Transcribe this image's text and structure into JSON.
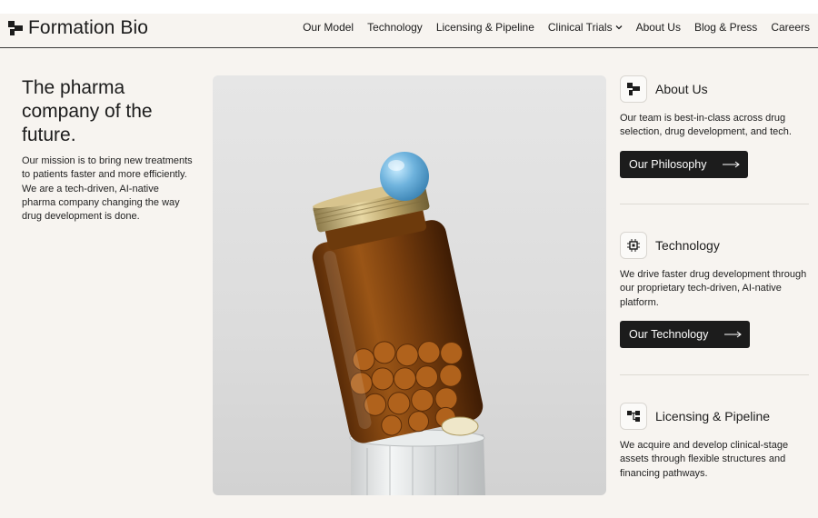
{
  "brand": {
    "name": "Formation Bio",
    "logo_icon": "formation-bio-logo"
  },
  "nav": {
    "items": [
      {
        "label": "Our Model"
      },
      {
        "label": "Technology"
      },
      {
        "label": "Licensing & Pipeline"
      },
      {
        "label": "Clinical Trials",
        "has_dropdown": true
      },
      {
        "label": "About Us"
      },
      {
        "label": "Blog & Press"
      },
      {
        "label": "Careers"
      }
    ]
  },
  "hero": {
    "title": "The pharma company of the future.",
    "description": "Our mission is to bring new treatments to patients faster and more efficiently. We are a tech-driven, AI-native pharma company changing the way drug development is done."
  },
  "features": [
    {
      "title": "About Us",
      "icon": "blocks-icon",
      "description": "Our team is best-in-class across drug selection, drug development, and tech.",
      "cta": "Our Philosophy"
    },
    {
      "title": "Technology",
      "icon": "chip-icon",
      "description": "We drive faster drug development through our proprietary tech-driven, AI-native platform.",
      "cta": "Our Technology"
    },
    {
      "title": "Licensing & Pipeline",
      "icon": "pipeline-icon",
      "description": "We acquire and develop clinical-stage assets through flexible structures and financing pathways."
    }
  ],
  "colors": {
    "background": "#f7f4f0",
    "button": "#1c1c1c",
    "accent_blue": "#6fb3dd",
    "amber": "#8a4a12"
  }
}
